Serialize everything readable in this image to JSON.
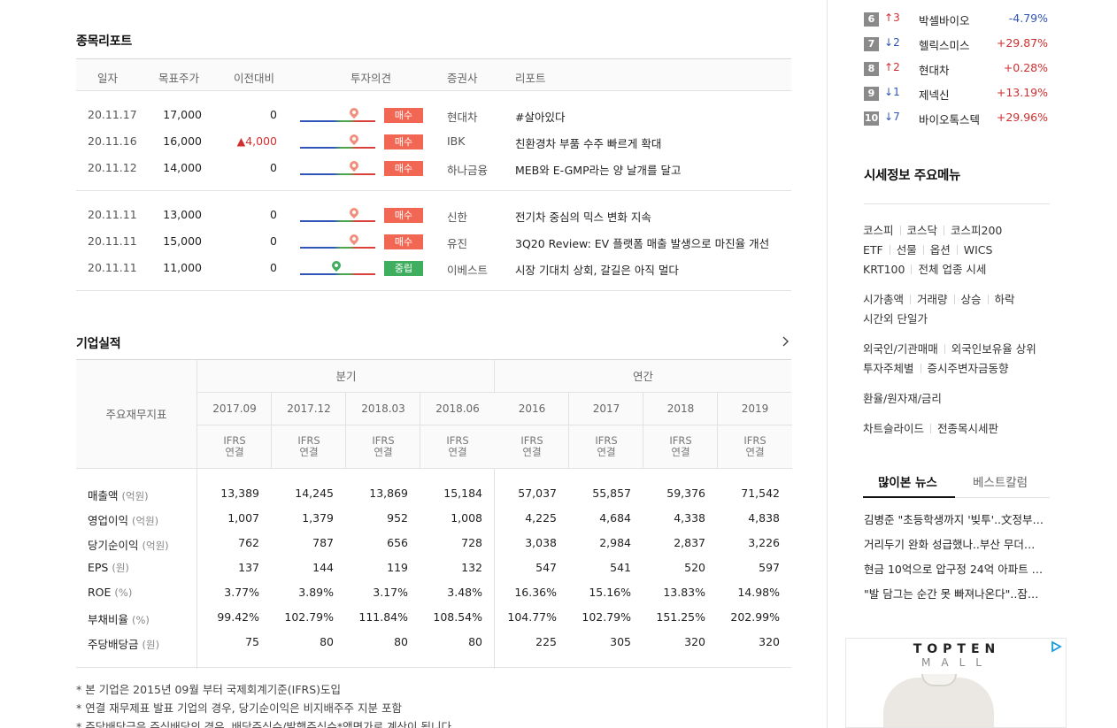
{
  "reports": {
    "title": "종목리포트",
    "headers": [
      "일자",
      "목표주가",
      "이전대비",
      "투자의견",
      "증권사",
      "리포트"
    ],
    "groups": [
      [
        {
          "date": "20.11.17",
          "target": "17,000",
          "change": "0",
          "change_up": false,
          "opinion": "매수",
          "opinion_color": "#f26654",
          "pin_color": "#f0907c",
          "pin_pos": 0.72,
          "broker": "현대차",
          "title": "#살아있다"
        },
        {
          "date": "20.11.16",
          "target": "16,000",
          "change": "▲4,000",
          "change_up": true,
          "opinion": "매수",
          "opinion_color": "#f26654",
          "pin_color": "#f0907c",
          "pin_pos": 0.72,
          "broker": "IBK",
          "title": "친환경차 부품 수주 빠르게 확대"
        },
        {
          "date": "20.11.12",
          "target": "14,000",
          "change": "0",
          "change_up": false,
          "opinion": "매수",
          "opinion_color": "#f26654",
          "pin_color": "#f0907c",
          "pin_pos": 0.72,
          "broker": "하나금융",
          "title": "MEB와 E-GMP라는 양 날개를 달고"
        }
      ],
      [
        {
          "date": "20.11.11",
          "target": "13,000",
          "change": "0",
          "change_up": false,
          "opinion": "매수",
          "opinion_color": "#f26654",
          "pin_color": "#f0907c",
          "pin_pos": 0.72,
          "broker": "신한",
          "title": "전기차 중심의 믹스 변화 지속"
        },
        {
          "date": "20.11.11",
          "target": "15,000",
          "change": "0",
          "change_up": false,
          "opinion": "매수",
          "opinion_color": "#f26654",
          "pin_color": "#f0907c",
          "pin_pos": 0.72,
          "broker": "유진",
          "title": "3Q20 Review: EV 플랫폼 매출 발생으로 마진율 개선"
        },
        {
          "date": "20.11.11",
          "target": "11,000",
          "change": "0",
          "change_up": false,
          "opinion": "중립",
          "opinion_color": "#3fae5f",
          "pin_color": "#3fae5f",
          "pin_pos": 0.48,
          "broker": "이베스트",
          "title": "시장 기대치 상회, 갈길은 아직 멀다"
        }
      ]
    ]
  },
  "financials": {
    "title": "기업실적",
    "more_icon": "chevron-right-icon",
    "row_header": "주요재무지표",
    "group_headers": [
      "분기",
      "연간"
    ],
    "periods": [
      "2017.09",
      "2017.12",
      "2018.03",
      "2018.06",
      "2016",
      "2017",
      "2018",
      "2019"
    ],
    "ifrs_line1": "IFRS",
    "ifrs_line2": "연결",
    "rows": [
      {
        "label": "매출액",
        "unit": "(억원)",
        "values": [
          "13,389",
          "14,245",
          "13,869",
          "15,184",
          "57,037",
          "55,857",
          "59,376",
          "71,542"
        ]
      },
      {
        "label": "영업이익",
        "unit": "(억원)",
        "values": [
          "1,007",
          "1,379",
          "952",
          "1,008",
          "4,225",
          "4,684",
          "4,338",
          "4,838"
        ]
      },
      {
        "label": "당기순이익",
        "unit": "(억원)",
        "values": [
          "762",
          "787",
          "656",
          "728",
          "3,038",
          "2,984",
          "2,837",
          "3,226"
        ]
      },
      {
        "label": "EPS",
        "unit": "(원)",
        "values": [
          "137",
          "144",
          "119",
          "132",
          "547",
          "541",
          "520",
          "597"
        ]
      },
      {
        "label": "ROE",
        "unit": "(%)",
        "values": [
          "3.77%",
          "3.89%",
          "3.17%",
          "3.48%",
          "16.36%",
          "15.16%",
          "13.83%",
          "14.98%"
        ]
      },
      {
        "label": "부채비율",
        "unit": "(%)",
        "values": [
          "99.42%",
          "102.79%",
          "111.84%",
          "108.54%",
          "104.77%",
          "102.79%",
          "151.25%",
          "202.99%"
        ]
      },
      {
        "label": "주당배당금",
        "unit": "(원)",
        "values": [
          "75",
          "80",
          "80",
          "80",
          "225",
          "305",
          "320",
          "320"
        ]
      }
    ],
    "notes": [
      "* 본 기업은 2015년 09월 부터 국제회계기준(IFRS)도입",
      "* 연결 재무제표 발표 기업의 경우, 당기순이익은 비지배주주 지분 포함",
      "* 주당배당금은 주식배당의 경우, 배당주식수/발행주식수*액면가로 계산이 됩니다"
    ]
  },
  "ranking": [
    {
      "rank": "6",
      "dir": "up",
      "move": "3",
      "name": "박셀바이오",
      "pct": "-4.79%",
      "pct_dir": "dn"
    },
    {
      "rank": "7",
      "dir": "dn",
      "move": "2",
      "name": "헬릭스미스",
      "pct": "+29.87%",
      "pct_dir": "up"
    },
    {
      "rank": "8",
      "dir": "up",
      "move": "2",
      "name": "현대차",
      "pct": "+0.28%",
      "pct_dir": "up"
    },
    {
      "rank": "9",
      "dir": "dn",
      "move": "1",
      "name": "제넥신",
      "pct": "+13.19%",
      "pct_dir": "up"
    },
    {
      "rank": "10",
      "dir": "dn",
      "move": "7",
      "name": "바이오톡스텍",
      "pct": "+29.96%",
      "pct_dir": "up"
    }
  ],
  "menu": {
    "title": "시세정보 주요메뉴",
    "rows": [
      [
        "코스피",
        "코스닥",
        "코스피200"
      ],
      [
        "ETF",
        "선물",
        "옵션",
        "WICS"
      ],
      [
        "KRT100",
        "전체 업종 시세"
      ],
      [
        "시가총액",
        "거래량",
        "상승",
        "하락"
      ],
      [
        "시간외 단일가"
      ],
      [
        "외국인/기관매매",
        "외국인보유율 상위"
      ],
      [
        "투자주체별",
        "증시주변자금동향"
      ],
      [
        "환율/원자재/금리"
      ],
      [
        "차트슬라이드",
        "전종목시세판"
      ]
    ]
  },
  "news": {
    "tabs": [
      "많이본 뉴스",
      "베스트칼럼"
    ],
    "items": [
      "김병준 \"초등학생까지 '빚투'..文정부…",
      "거리두기 완화 성급했나..부산 무더…",
      "현금 10억으로 압구정 24억 아파트 …",
      "\"발 담그는 순간 못 빠져나온다\"..잠…"
    ]
  },
  "ad": {
    "brand_line1": "TOPTEN",
    "brand_line2": "MALL",
    "info_icon": "ad-choices-icon"
  },
  "colors": {
    "up": "#d12f2f",
    "down": "#2f55b8",
    "buy": "#f26654",
    "neutral": "#3fae5f"
  }
}
